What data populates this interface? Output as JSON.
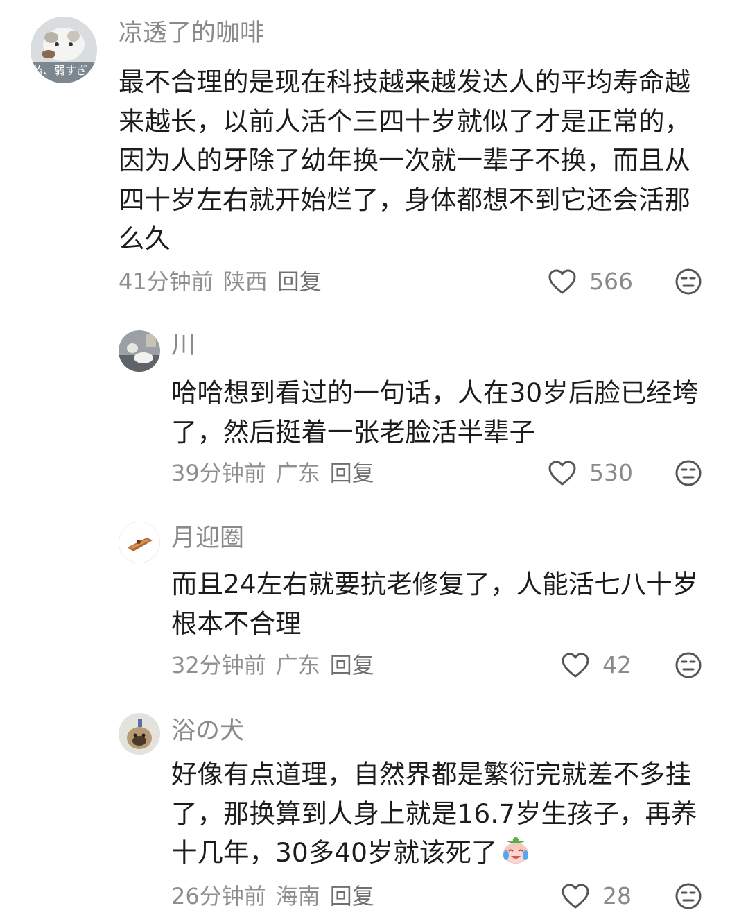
{
  "icons": {
    "like": "heart-outline-icon",
    "dislike": "meh-face-icon",
    "emoji": "crying-laughing-peach-emoji"
  },
  "colors": {
    "text": "#1c1c1c",
    "username": "#8a8a8a",
    "meta": "#8f8f8f"
  },
  "comments": [
    {
      "username": "凉透了的咖啡",
      "avatar_caption": "怂、弱すぎ",
      "content": "最不合理的是现在科技越来越发达人的平均寿命越来越长，以前人活个三四十岁就似了才是正常的，因为人的牙除了幼年换一次就一辈子不换，而且从四十岁左右就开始烂了，身体都想不到它还会活那么久",
      "time": "41分钟前",
      "location": "陕西",
      "reply_label": "回复",
      "likes": "566"
    },
    {
      "username": "川",
      "content": "哈哈想到看过的一句话，人在30岁后脸已经垮了，然后挺着一张老脸活半辈子",
      "time": "39分钟前",
      "location": "广东",
      "reply_label": "回复",
      "likes": "530"
    },
    {
      "username": "月迎圈",
      "content": "而且24左右就要抗老修复了，人能活七八十岁根本不合理",
      "time": "32分钟前",
      "location": "广东",
      "reply_label": "回复",
      "likes": "42"
    },
    {
      "username": "浴の犬",
      "content": "好像有点道理，自然界都是繁衍完就差不多挂了，那换算到人身上就是16.7岁生孩子，再养十几年，30多40岁就该死了",
      "time": "26分钟前",
      "location": "海南",
      "reply_label": "回复",
      "likes": "28"
    }
  ]
}
